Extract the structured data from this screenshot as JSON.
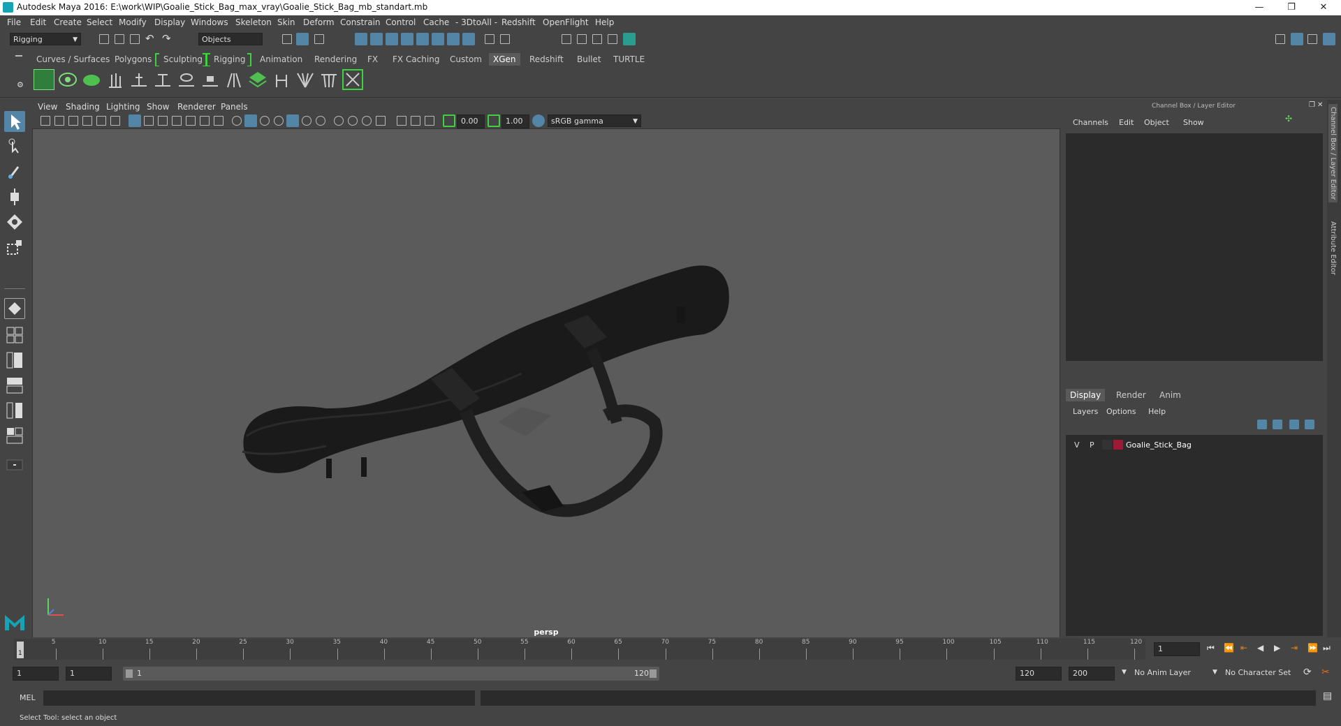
{
  "window": {
    "title": "Autodesk Maya 2016: E:\\work\\WIP\\Goalie_Stick_Bag_max_vray\\Goalie_Stick_Bag_mb_standart.mb",
    "minimize": "—",
    "restore": "❐",
    "close": "✕"
  },
  "menus": [
    "File",
    "Edit",
    "Create",
    "Select",
    "Modify",
    "Display",
    "Windows",
    "Skeleton",
    "Skin",
    "Deform",
    "Constrain",
    "Control",
    "Cache",
    "- 3DtoAll -",
    "Redshift",
    "OpenFlight",
    "Help"
  ],
  "status": {
    "menuset": "Rigging",
    "selection_mask": "Objects"
  },
  "shelf_tabs": [
    "Curves / Surfaces",
    "Polygons",
    "Sculpting",
    "Rigging",
    "Animation",
    "Rendering",
    "FX",
    "FX Caching",
    "Custom",
    "XGen",
    "Redshift",
    "Bullet",
    "TURTLE"
  ],
  "shelf_active": "XGen",
  "viewport": {
    "menus": [
      "View",
      "Shading",
      "Lighting",
      "Show",
      "Renderer",
      "Panels"
    ],
    "exposure": "0.00",
    "gamma": "1.00",
    "color_space": "sRGB gamma",
    "camera_label": "persp"
  },
  "channel_box": {
    "title": "Channel Box / Layer Editor",
    "menus": [
      "Channels",
      "Edit",
      "Object",
      "Show"
    ],
    "side_tabs": [
      "Channel Box / Layer Editor",
      "Attribute Editor"
    ]
  },
  "layer_editor": {
    "tabs": [
      "Display",
      "Render",
      "Anim"
    ],
    "active_tab": "Display",
    "menus": [
      "Layers",
      "Options",
      "Help"
    ],
    "layers": [
      {
        "v": "V",
        "p": "P",
        "color": "#9c1a38",
        "name": "Goalie_Stick_Bag"
      }
    ]
  },
  "timeline": {
    "ticks": [
      "5",
      "10",
      "15",
      "20",
      "25",
      "30",
      "35",
      "40",
      "45",
      "50",
      "55",
      "60",
      "65",
      "70",
      "75",
      "80",
      "85",
      "90",
      "95",
      "100",
      "105",
      "110",
      "115",
      "120"
    ],
    "start_mark": "1",
    "current_frame": "1"
  },
  "range": {
    "start": "1",
    "anim_start": "1",
    "range_start_label": "1",
    "range_end_label": "120",
    "playback_end": "120",
    "anim_end": "200",
    "anim_layer": "No Anim Layer",
    "character_set": "No Character Set"
  },
  "command": {
    "mel_label": "MEL"
  },
  "help_line": "Select Tool: select an object"
}
